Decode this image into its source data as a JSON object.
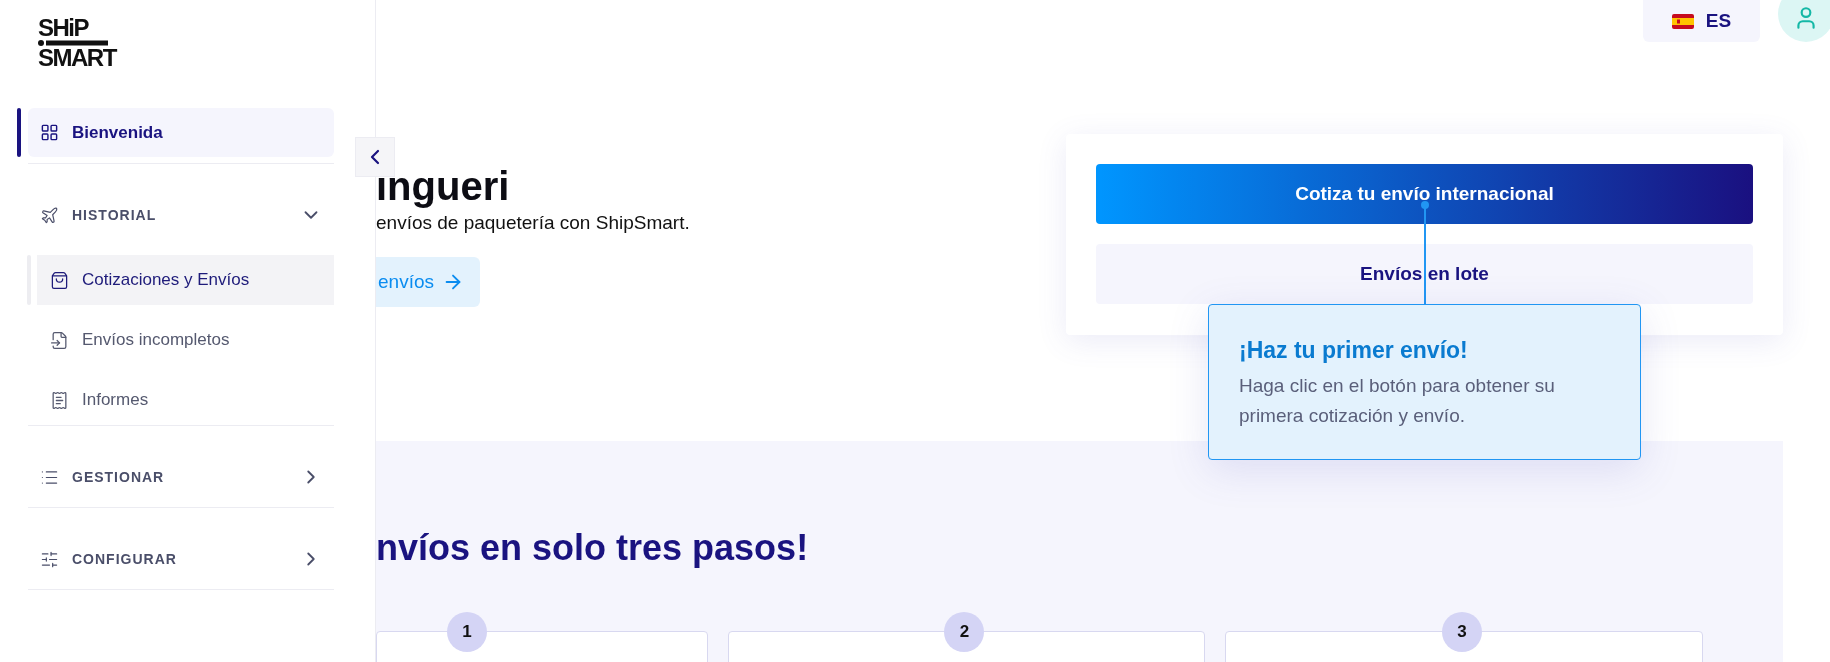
{
  "sidebar": {
    "logo": {
      "line_1": "SHiP",
      "line_2": "SMART"
    },
    "nav": [
      {
        "kind": "link",
        "label": "Bienvenida",
        "selected": true
      },
      {
        "kind": "group",
        "label": "HISTORIAL",
        "expanded": true,
        "children": [
          {
            "label": "Cotizaciones y Envíos",
            "selected": true
          },
          {
            "label": "Envíos incompletos",
            "selected": false
          },
          {
            "label": "Informes",
            "selected": false
          }
        ]
      },
      {
        "kind": "group",
        "label": "GESTIONAR",
        "expanded": false
      },
      {
        "kind": "group",
        "label": "CONFIGURAR",
        "expanded": false
      }
    ]
  },
  "topbar": {
    "language": "ES"
  },
  "hero": {
    "title": "ingueri",
    "subtitle": "envíos de paquetería con ShipSmart.",
    "link_button": "envíos"
  },
  "actions_card": {
    "buttons": [
      {
        "kind": "primary",
        "label": "Cotiza tu envío internacional"
      },
      {
        "kind": "secondary",
        "label": "Envíos en lote"
      }
    ],
    "tooltip": {
      "title": "¡Haz tu primer envío!",
      "body": "Haga clic en el botón para obtener su primera cotización y envío."
    }
  },
  "steps_section": {
    "title": "nvíos en solo tres pasos!",
    "steps": [
      {
        "number": "1"
      },
      {
        "number": "2"
      },
      {
        "number": "3"
      }
    ]
  }
}
